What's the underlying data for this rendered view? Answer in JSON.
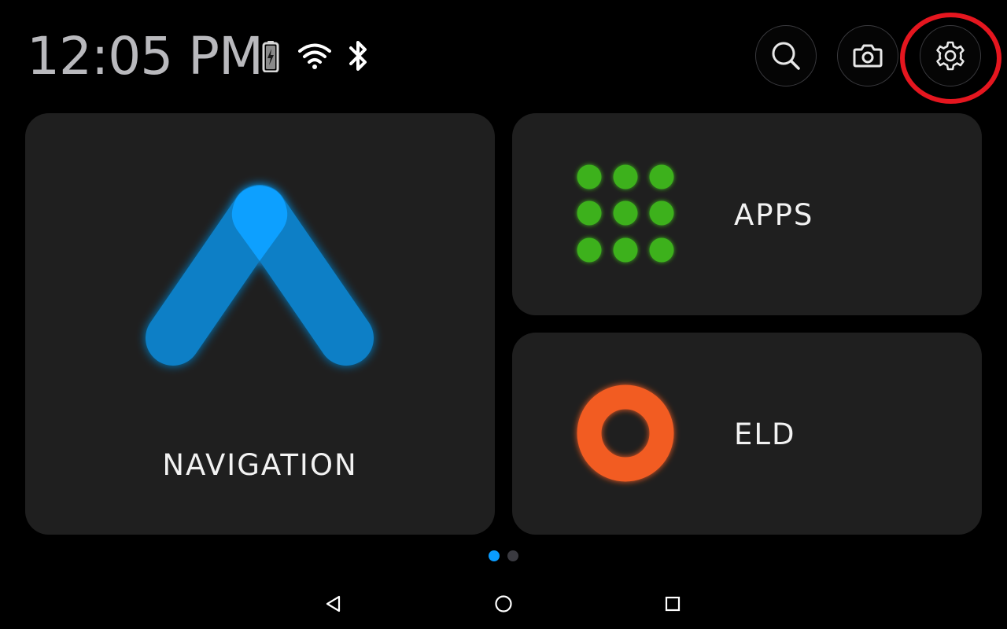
{
  "status_bar": {
    "time": "12:05 PM",
    "icons": [
      "battery-charging-icon",
      "wifi-icon",
      "bluetooth-icon"
    ]
  },
  "top_actions": [
    {
      "name": "search",
      "icon": "search-icon"
    },
    {
      "name": "camera",
      "icon": "camera-icon"
    },
    {
      "name": "settings",
      "icon": "gear-icon",
      "highlighted": true
    }
  ],
  "tiles": {
    "navigation": {
      "label": "NAVIGATION",
      "icon": "navigation-arrow-icon",
      "color": "#0a8fe0"
    },
    "apps": {
      "label": "APPS",
      "icon": "apps-grid-icon",
      "color": "#3cb11f"
    },
    "eld": {
      "label": "ELD",
      "icon": "eld-ring-icon",
      "color": "#f25c22"
    }
  },
  "pager": {
    "total": 2,
    "current": 1
  },
  "system_nav": [
    {
      "name": "back",
      "icon": "back-triangle-icon"
    },
    {
      "name": "home",
      "icon": "home-circle-icon"
    },
    {
      "name": "recents",
      "icon": "recents-square-icon"
    }
  ],
  "colors": {
    "background": "#000000",
    "tile": "#1f1f1f",
    "accent_blue": "#0a9cff",
    "highlight_red": "#e5161f"
  }
}
